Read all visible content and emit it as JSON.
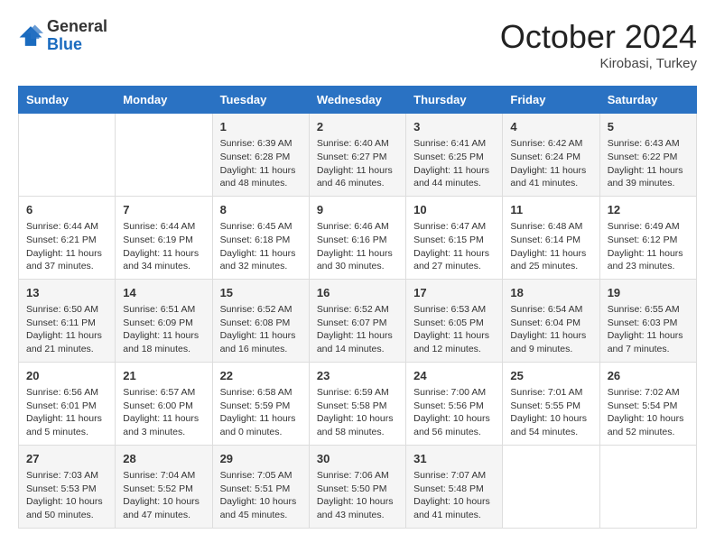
{
  "header": {
    "logo": {
      "general": "General",
      "blue": "Blue"
    },
    "month": "October 2024",
    "location": "Kirobasi, Turkey"
  },
  "weekdays": [
    "Sunday",
    "Monday",
    "Tuesday",
    "Wednesday",
    "Thursday",
    "Friday",
    "Saturday"
  ],
  "weeks": [
    [
      {
        "day": null
      },
      {
        "day": null
      },
      {
        "day": "1",
        "sunrise": "6:39 AM",
        "sunset": "6:28 PM",
        "daylight": "11 hours and 48 minutes."
      },
      {
        "day": "2",
        "sunrise": "6:40 AM",
        "sunset": "6:27 PM",
        "daylight": "11 hours and 46 minutes."
      },
      {
        "day": "3",
        "sunrise": "6:41 AM",
        "sunset": "6:25 PM",
        "daylight": "11 hours and 44 minutes."
      },
      {
        "day": "4",
        "sunrise": "6:42 AM",
        "sunset": "6:24 PM",
        "daylight": "11 hours and 41 minutes."
      },
      {
        "day": "5",
        "sunrise": "6:43 AM",
        "sunset": "6:22 PM",
        "daylight": "11 hours and 39 minutes."
      }
    ],
    [
      {
        "day": "6",
        "sunrise": "6:44 AM",
        "sunset": "6:21 PM",
        "daylight": "11 hours and 37 minutes."
      },
      {
        "day": "7",
        "sunrise": "6:44 AM",
        "sunset": "6:19 PM",
        "daylight": "11 hours and 34 minutes."
      },
      {
        "day": "8",
        "sunrise": "6:45 AM",
        "sunset": "6:18 PM",
        "daylight": "11 hours and 32 minutes."
      },
      {
        "day": "9",
        "sunrise": "6:46 AM",
        "sunset": "6:16 PM",
        "daylight": "11 hours and 30 minutes."
      },
      {
        "day": "10",
        "sunrise": "6:47 AM",
        "sunset": "6:15 PM",
        "daylight": "11 hours and 27 minutes."
      },
      {
        "day": "11",
        "sunrise": "6:48 AM",
        "sunset": "6:14 PM",
        "daylight": "11 hours and 25 minutes."
      },
      {
        "day": "12",
        "sunrise": "6:49 AM",
        "sunset": "6:12 PM",
        "daylight": "11 hours and 23 minutes."
      }
    ],
    [
      {
        "day": "13",
        "sunrise": "6:50 AM",
        "sunset": "6:11 PM",
        "daylight": "11 hours and 21 minutes."
      },
      {
        "day": "14",
        "sunrise": "6:51 AM",
        "sunset": "6:09 PM",
        "daylight": "11 hours and 18 minutes."
      },
      {
        "day": "15",
        "sunrise": "6:52 AM",
        "sunset": "6:08 PM",
        "daylight": "11 hours and 16 minutes."
      },
      {
        "day": "16",
        "sunrise": "6:52 AM",
        "sunset": "6:07 PM",
        "daylight": "11 hours and 14 minutes."
      },
      {
        "day": "17",
        "sunrise": "6:53 AM",
        "sunset": "6:05 PM",
        "daylight": "11 hours and 12 minutes."
      },
      {
        "day": "18",
        "sunrise": "6:54 AM",
        "sunset": "6:04 PM",
        "daylight": "11 hours and 9 minutes."
      },
      {
        "day": "19",
        "sunrise": "6:55 AM",
        "sunset": "6:03 PM",
        "daylight": "11 hours and 7 minutes."
      }
    ],
    [
      {
        "day": "20",
        "sunrise": "6:56 AM",
        "sunset": "6:01 PM",
        "daylight": "11 hours and 5 minutes."
      },
      {
        "day": "21",
        "sunrise": "6:57 AM",
        "sunset": "6:00 PM",
        "daylight": "11 hours and 3 minutes."
      },
      {
        "day": "22",
        "sunrise": "6:58 AM",
        "sunset": "5:59 PM",
        "daylight": "11 hours and 0 minutes."
      },
      {
        "day": "23",
        "sunrise": "6:59 AM",
        "sunset": "5:58 PM",
        "daylight": "10 hours and 58 minutes."
      },
      {
        "day": "24",
        "sunrise": "7:00 AM",
        "sunset": "5:56 PM",
        "daylight": "10 hours and 56 minutes."
      },
      {
        "day": "25",
        "sunrise": "7:01 AM",
        "sunset": "5:55 PM",
        "daylight": "10 hours and 54 minutes."
      },
      {
        "day": "26",
        "sunrise": "7:02 AM",
        "sunset": "5:54 PM",
        "daylight": "10 hours and 52 minutes."
      }
    ],
    [
      {
        "day": "27",
        "sunrise": "7:03 AM",
        "sunset": "5:53 PM",
        "daylight": "10 hours and 50 minutes."
      },
      {
        "day": "28",
        "sunrise": "7:04 AM",
        "sunset": "5:52 PM",
        "daylight": "10 hours and 47 minutes."
      },
      {
        "day": "29",
        "sunrise": "7:05 AM",
        "sunset": "5:51 PM",
        "daylight": "10 hours and 45 minutes."
      },
      {
        "day": "30",
        "sunrise": "7:06 AM",
        "sunset": "5:50 PM",
        "daylight": "10 hours and 43 minutes."
      },
      {
        "day": "31",
        "sunrise": "7:07 AM",
        "sunset": "5:48 PM",
        "daylight": "10 hours and 41 minutes."
      },
      {
        "day": null
      },
      {
        "day": null
      }
    ]
  ],
  "labels": {
    "sunrise": "Sunrise:",
    "sunset": "Sunset:",
    "daylight": "Daylight:"
  }
}
